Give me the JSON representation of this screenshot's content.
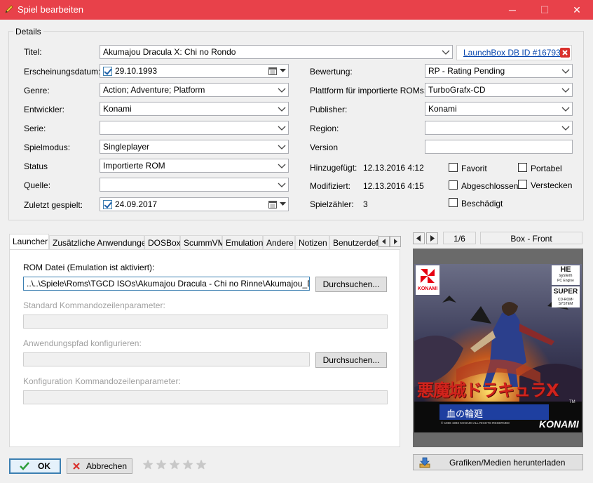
{
  "window": {
    "title": "Spiel bearbeiten",
    "minimize": "─",
    "maximize": "☐",
    "close": "✕"
  },
  "details": {
    "group_label": "Details",
    "title_label": "Titel:",
    "title_value": "Akumajou Dracula X: Chi no Rondo",
    "launchbox_link": "LaunchBox DB ID #16793",
    "release_label": "Erscheinungsdatum:",
    "release_value": "29.10.1993",
    "genre_label": "Genre:",
    "genre_value": "Action; Adventure; Platform",
    "developer_label": "Entwickler:",
    "developer_value": "Konami",
    "series_label": "Serie:",
    "series_value": "",
    "playmode_label": "Spielmodus:",
    "playmode_value": "Singleplayer",
    "status_label": "Status",
    "status_value": "Importierte ROM",
    "source_label": "Quelle:",
    "source_value": "",
    "lastplayed_label": "Zuletzt gespielt:",
    "lastplayed_value": "24.09.2017",
    "rating_label": "Bewertung:",
    "rating_value": "RP - Rating Pending",
    "platform_label": "Plattform für importierte ROMs:",
    "platform_value": "TurboGrafx-CD",
    "publisher_label": "Publisher:",
    "publisher_value": "Konami",
    "region_label": "Region:",
    "region_value": "",
    "version_label": "Version",
    "version_value": "",
    "added_label": "Hinzugefügt:",
    "added_value": "12.13.2016 4:12",
    "modified_label": "Modifiziert:",
    "modified_value": "12.13.2016 4:15",
    "playcount_label": "Spielzähler:",
    "playcount_value": "3",
    "checkboxes": {
      "favorite": "Favorit",
      "portable": "Portabel",
      "completed": "Abgeschlossen",
      "hide": "Verstecken",
      "broken": "Beschädigt"
    }
  },
  "tabs": [
    "Launcher",
    "Zusätzliche Anwendungen",
    "DOSBox",
    "ScummVM",
    "Emulation",
    "Andere",
    "Notizen",
    "Benutzerdefi"
  ],
  "launcher": {
    "rom_label": "ROM Datei (Emulation ist aktiviert):",
    "rom_value": "..\\..\\Spiele\\Roms\\TGCD ISOs\\Akumajou Dracula - Chi no Rinne\\Akumajou_Dracula_X",
    "browse1": "Durchsuchen...",
    "cmdline_label": "Standard Kommandozeilenparameter:",
    "apppath_label": "Anwendungspfad konfigurieren:",
    "browse2": "Durchsuchen...",
    "config_cmd_label": "Konfiguration Kommandozeilenparameter:"
  },
  "media": {
    "counter": "1/6",
    "type": "Box - Front",
    "download_button": "Grafiken/Medien herunterladen",
    "cover": {
      "publisher_logo": "KONAMI",
      "system_logo_1": "HE",
      "system_logo_2": "system",
      "system_logo_3": "PC Engine",
      "super_label": "SUPER",
      "cd_rom_label": "CD-ROM² SYSTEM",
      "japanese_title": "悪魔城ドラキュラX",
      "japanese_subtitle": "血の輪廻",
      "tm": "TM",
      "copyright": "© 1966 1993 KONAMI ALL RIGHTS RESERVED",
      "konami_bottom": "KONAMI"
    }
  },
  "footer": {
    "ok_label": "OK",
    "cancel_label": "Abbrechen",
    "stars": [
      "★",
      "★",
      "★",
      "★",
      "★"
    ],
    "rating_stars": 0
  },
  "colors": {
    "titlebar": "#e8414a",
    "link": "#0645ad",
    "accent_check": "#1c5fa8"
  }
}
